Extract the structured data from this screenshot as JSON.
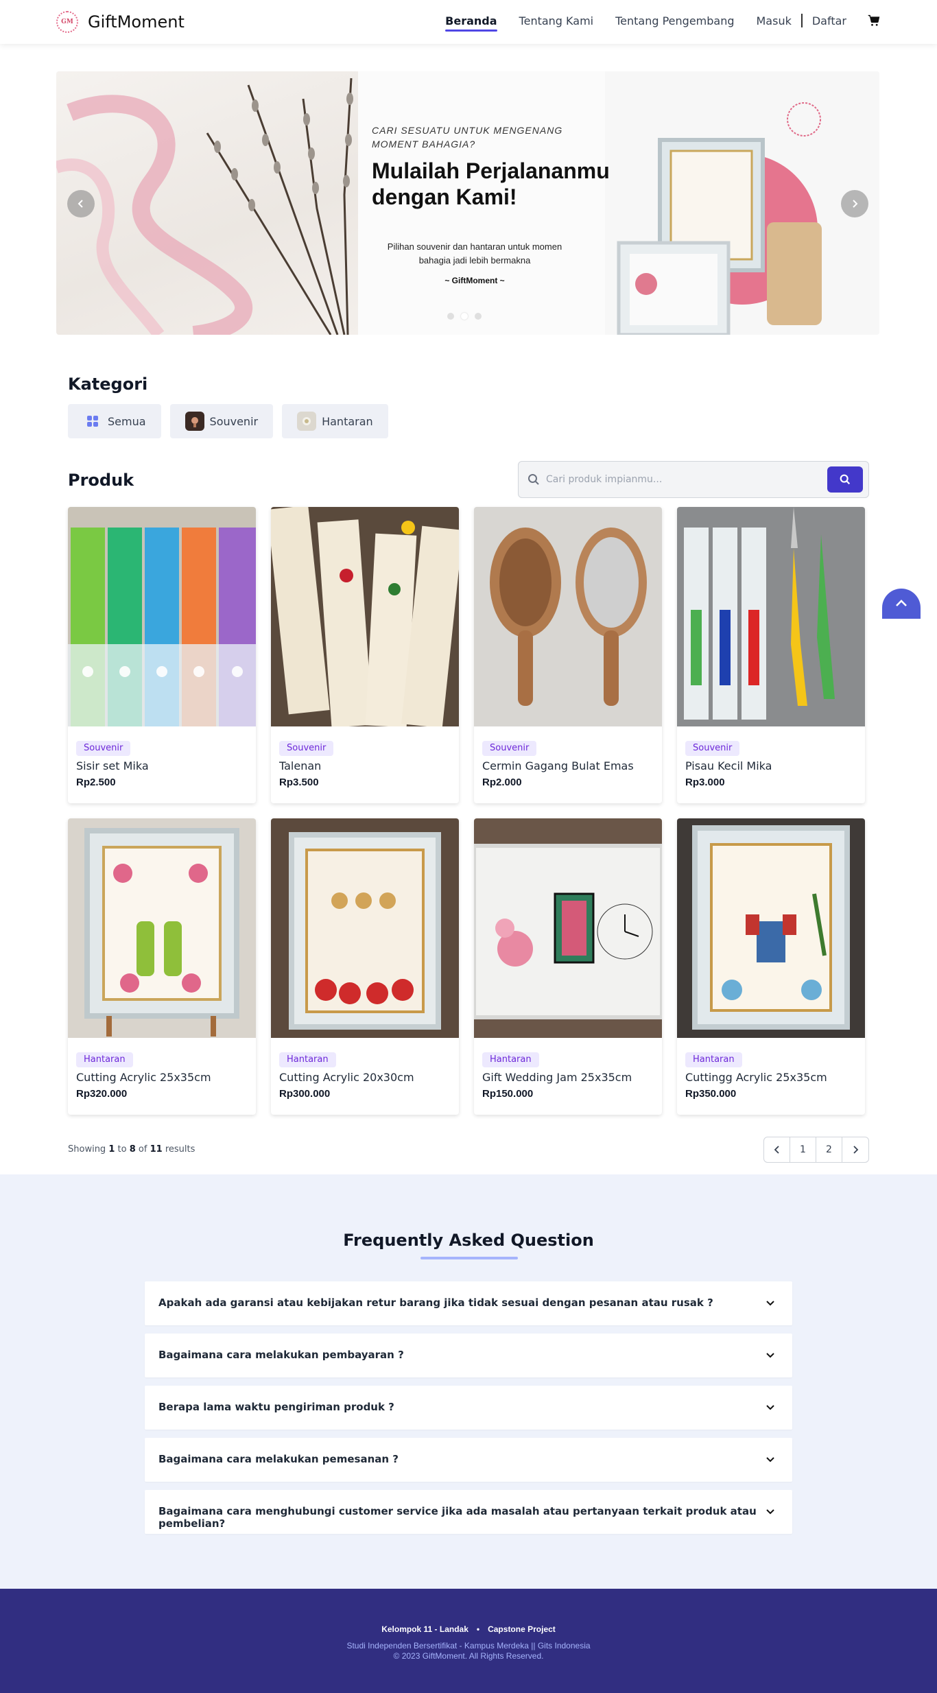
{
  "brand": {
    "name": "GiftMoment",
    "logo_text": "GM"
  },
  "nav": {
    "links": [
      "Beranda",
      "Tentang Kami",
      "Tentang Pengembang"
    ],
    "login": "Masuk",
    "register": "Daftar",
    "cart_icon": "cart-icon"
  },
  "hero": {
    "kicker": "CARI SESUATU UNTUK MENGENANG MOMENT BAHAGIA?",
    "title": "Mulailah Perjalananmu dengan Kami!",
    "subtitle": "Pilihan souvenir dan hantaran untuk momen bahagia jadi lebih bermakna",
    "signature": "~ GiftMoment ~",
    "slides_count": 3,
    "active_slide": 2
  },
  "categories": {
    "title": "Kategori",
    "items": [
      {
        "label": "Semua",
        "icon": "grid-icon"
      },
      {
        "label": "Souvenir",
        "icon": "souvenir-thumbnail"
      },
      {
        "label": "Hantaran",
        "icon": "hantaran-thumbnail"
      }
    ]
  },
  "products": {
    "title": "Produk",
    "search_placeholder": "Cari produk impianmu...",
    "items": [
      {
        "category": "Souvenir",
        "name": "Sisir set Mika",
        "price": "Rp2.500"
      },
      {
        "category": "Souvenir",
        "name": "Talenan",
        "price": "Rp3.500"
      },
      {
        "category": "Souvenir",
        "name": "Cermin Gagang Bulat Emas",
        "price": "Rp2.000"
      },
      {
        "category": "Souvenir",
        "name": "Pisau Kecil Mika",
        "price": "Rp3.000"
      },
      {
        "category": "Hantaran",
        "name": "Cutting Acrylic 25x35cm",
        "price": "Rp320.000"
      },
      {
        "category": "Hantaran",
        "name": "Cutting Acrylic 20x30cm",
        "price": "Rp300.000"
      },
      {
        "category": "Hantaran",
        "name": "Gift Wedding Jam 25x35cm",
        "price": "Rp150.000"
      },
      {
        "category": "Hantaran",
        "name": "Cuttingg Acrylic 25x35cm",
        "price": "Rp350.000"
      }
    ]
  },
  "pagination": {
    "showing_prefix": "Showing",
    "from": "1",
    "to_word": "to",
    "to": "8",
    "of_word": "of",
    "total": "11",
    "results_word": "results",
    "pages": [
      "1",
      "2"
    ]
  },
  "faq": {
    "title": "Frequently Asked Question",
    "questions": [
      "Apakah ada garansi atau kebijakan retur barang jika tidak sesuai dengan pesanan atau rusak ?",
      "Bagaimana cara melakukan pembayaran ?",
      "Berapa lama waktu pengiriman produk ?",
      "Bagaimana cara melakukan pemesanan ?",
      "Bagaimana cara menghubungi customer service jika ada masalah atau pertanyaan terkait produk atau pembelian?"
    ]
  },
  "footer": {
    "group": "Kelompok 11 - Landak",
    "project": "Capstone Project",
    "program": "Studi Independen Bersertifikat - Kampus Merdeka || Gits Indonesia",
    "copyright": "© 2023 GiftMoment. All Rights Reserved."
  },
  "colors": {
    "accent": "#4338ca",
    "badge_bg": "#ede9fe",
    "badge_text": "#6d28d9",
    "faq_bg": "#eef2fb",
    "footer_bg": "#312e81"
  }
}
